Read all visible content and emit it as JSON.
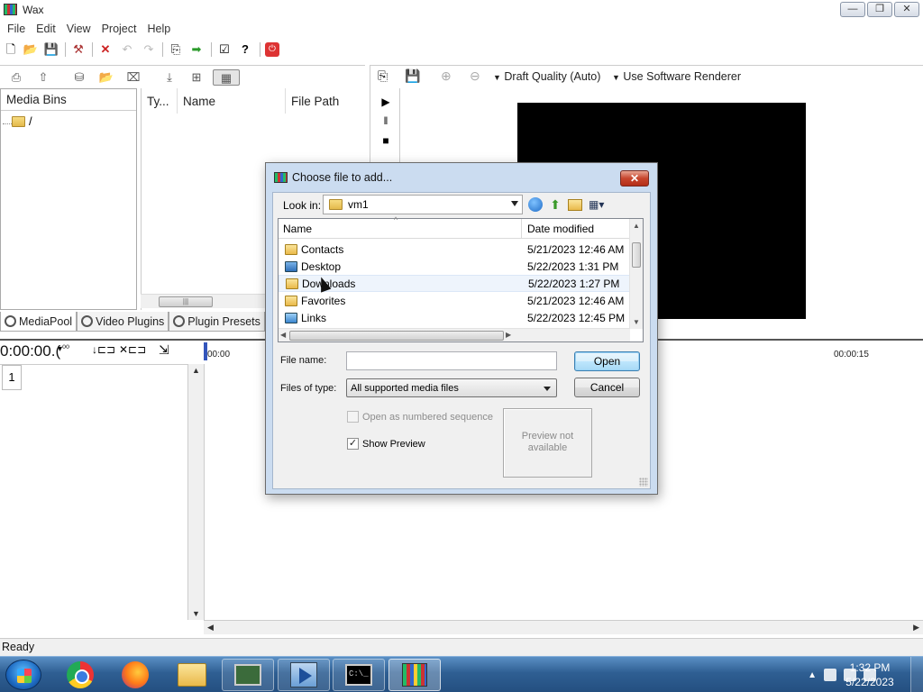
{
  "app": {
    "title": "Wax",
    "window_buttons": [
      "—",
      "❐",
      "✕"
    ]
  },
  "menu": [
    "File",
    "Edit",
    "View",
    "Project",
    "Help"
  ],
  "main_toolbar": {
    "icons": [
      "new-file-icon",
      "open-folder-icon",
      "save-icon",
      "hammer-icon",
      "delete-icon",
      "undo-icon",
      "redo-icon",
      "export-icon",
      "forward-icon",
      "properties-icon",
      "help-icon",
      "record-icon"
    ]
  },
  "media_panel": {
    "bins_header": "Media Bins",
    "bins_root": "/",
    "columns": [
      "Ty...",
      "Name",
      "File Path"
    ],
    "hscroll_thumb": "|||",
    "tabs": [
      "MediaPool",
      "Video Plugins",
      "Plugin Presets"
    ]
  },
  "preview_panel": {
    "quality": "Draft Quality (Auto)",
    "renderer": "Use Software Renderer",
    "play_icons": [
      "▶",
      "‖",
      "■"
    ]
  },
  "timeline": {
    "timecode": "0:00:00.(",
    "ruler_ticks": [
      "00:00",
      "00:00:15"
    ],
    "tracks": [
      "1"
    ]
  },
  "status": "Ready",
  "dialog": {
    "title": "Choose file to add...",
    "close": "✕",
    "look_in_label": "Look in:",
    "look_in_value": "vm1",
    "columns": {
      "name": "Name",
      "date": "Date modified"
    },
    "files": [
      {
        "name": "Contacts",
        "date": "5/21/2023 12:46 AM"
      },
      {
        "name": "Desktop",
        "date": "5/22/2023 1:31 PM"
      },
      {
        "name": "Downloads",
        "date": "5/22/2023 1:27 PM"
      },
      {
        "name": "Favorites",
        "date": "5/21/2023 12:46 AM"
      },
      {
        "name": "Links",
        "date": "5/22/2023 12:45 PM"
      }
    ],
    "hovered_file_index": 2,
    "file_name_label": "File name:",
    "file_name_value": "",
    "files_of_type_label": "Files of type:",
    "files_of_type_value": "All supported media files",
    "open_button": "Open",
    "cancel_button": "Cancel",
    "numbered_sequence_label": "Open as numbered sequence",
    "numbered_sequence_checked": false,
    "numbered_sequence_enabled": false,
    "show_preview_label": "Show Preview",
    "show_preview_checked": true,
    "preview_text_line1": "Preview not",
    "preview_text_line2": "available"
  },
  "taskbar": {
    "apps": [
      "Chrome",
      "Firefox",
      "Windows Explorer",
      "Virtual Machine",
      "Media Player",
      "Command Prompt",
      "Wax"
    ],
    "clock_time": "1:32 PM",
    "clock_date": "5/22/2023"
  }
}
